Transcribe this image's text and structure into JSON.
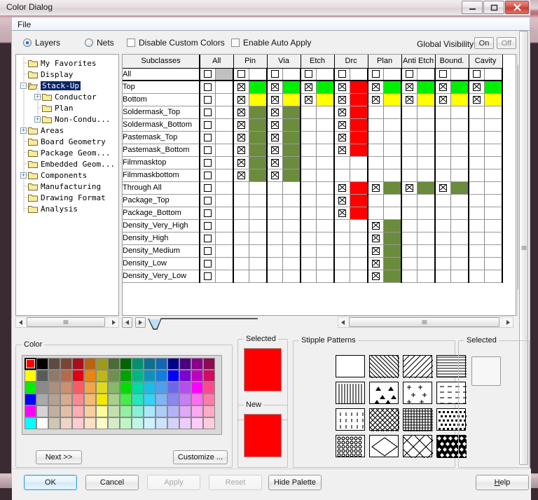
{
  "window": {
    "title": "Color Dialog",
    "controls": {
      "minimize": "minimize-icon",
      "maximize": "maximize-icon",
      "close": "close-icon"
    }
  },
  "menubar": {
    "file": "File"
  },
  "options": {
    "layers": "Layers",
    "nets": "Nets",
    "disable_custom_colors": "Disable Custom Colors",
    "enable_auto_apply": "Enable Auto Apply",
    "global_visibility_label": "Global Visibility:",
    "on": "On",
    "off": "Off"
  },
  "tree": {
    "items": [
      {
        "label": "My Favorites",
        "indent": 1,
        "expander": "",
        "selected": false
      },
      {
        "label": "Display",
        "indent": 1,
        "expander": "",
        "selected": false
      },
      {
        "label": "Stack-Up",
        "indent": 1,
        "expander": "-",
        "selected": true
      },
      {
        "label": "Conductor",
        "indent": 2,
        "expander": "+",
        "selected": false
      },
      {
        "label": "Plan",
        "indent": 2,
        "expander": "",
        "selected": false
      },
      {
        "label": "Non-Condu...",
        "indent": 2,
        "expander": "+",
        "selected": false
      },
      {
        "label": "Areas",
        "indent": 1,
        "expander": "+",
        "selected": false
      },
      {
        "label": "Board Geometry",
        "indent": 1,
        "expander": "",
        "selected": false
      },
      {
        "label": "Package Geom...",
        "indent": 1,
        "expander": "",
        "selected": false
      },
      {
        "label": "Embedded Geom...",
        "indent": 1,
        "expander": "",
        "selected": false
      },
      {
        "label": "Components",
        "indent": 1,
        "expander": "+",
        "selected": false
      },
      {
        "label": "Manufacturing",
        "indent": 1,
        "expander": "",
        "selected": false
      },
      {
        "label": "Drawing Format",
        "indent": 1,
        "expander": "",
        "selected": false
      },
      {
        "label": "Analysis",
        "indent": 1,
        "expander": "",
        "selected": false
      }
    ]
  },
  "table": {
    "columns": [
      "Subclasses",
      "All",
      "Pin",
      "Via",
      "Etch",
      "Drc",
      "Plan",
      "Anti Etch",
      "Bound.",
      "Cavity"
    ],
    "rows": [
      {
        "name": "All",
        "cells": [
          {
            "check": "empty",
            "color": "#c0c0c0"
          },
          {
            "check": "empty",
            "color": ""
          },
          {
            "check": "empty",
            "color": ""
          },
          {
            "check": "empty",
            "color": ""
          },
          {
            "check": "empty",
            "color": ""
          },
          {
            "check": "empty",
            "color": ""
          },
          {
            "check": "empty",
            "color": ""
          },
          {
            "check": "empty",
            "color": ""
          },
          {
            "check": "empty",
            "color": ""
          }
        ]
      },
      {
        "name": "Top",
        "cells": [
          {
            "check": "empty",
            "color": ""
          },
          {
            "check": "x",
            "color": "#00ee00"
          },
          {
            "check": "x",
            "color": "#00ee00"
          },
          {
            "check": "x",
            "color": "#00ee00"
          },
          {
            "check": "x",
            "color": "#ff0000"
          },
          {
            "check": "x",
            "color": "#00ee00"
          },
          {
            "check": "x",
            "color": "#00ee00"
          },
          {
            "check": "x",
            "color": "#00ee00"
          },
          {
            "check": "x",
            "color": "#00ee00"
          }
        ]
      },
      {
        "name": "Bottom",
        "cells": [
          {
            "check": "empty",
            "color": ""
          },
          {
            "check": "x",
            "color": "#ffff00"
          },
          {
            "check": "x",
            "color": "#ffff00"
          },
          {
            "check": "x",
            "color": "#ffff00"
          },
          {
            "check": "x",
            "color": "#ff0000"
          },
          {
            "check": "x",
            "color": "#ffff00"
          },
          {
            "check": "x",
            "color": "#ffff00"
          },
          {
            "check": "x",
            "color": "#ffff00"
          },
          {
            "check": "x",
            "color": "#ffff00"
          }
        ]
      },
      {
        "name": "Soldermask_Top",
        "cells": [
          {
            "check": "empty",
            "color": ""
          },
          {
            "check": "x",
            "color": "#6b8b3d"
          },
          {
            "check": "x",
            "color": "#6b8b3d"
          },
          {
            "check": "",
            "color": ""
          },
          {
            "check": "x",
            "color": "#ff0000"
          },
          {
            "check": "",
            "color": ""
          },
          {
            "check": "",
            "color": ""
          },
          {
            "check": "",
            "color": ""
          },
          {
            "check": "",
            "color": ""
          }
        ]
      },
      {
        "name": "Soldermask_Bottom",
        "cells": [
          {
            "check": "empty",
            "color": ""
          },
          {
            "check": "x",
            "color": "#6b8b3d"
          },
          {
            "check": "x",
            "color": "#6b8b3d"
          },
          {
            "check": "",
            "color": ""
          },
          {
            "check": "x",
            "color": "#ff0000"
          },
          {
            "check": "",
            "color": ""
          },
          {
            "check": "",
            "color": ""
          },
          {
            "check": "",
            "color": ""
          },
          {
            "check": "",
            "color": ""
          }
        ]
      },
      {
        "name": "Pastemask_Top",
        "cells": [
          {
            "check": "empty",
            "color": ""
          },
          {
            "check": "x",
            "color": "#6b8b3d"
          },
          {
            "check": "x",
            "color": "#6b8b3d"
          },
          {
            "check": "",
            "color": ""
          },
          {
            "check": "x",
            "color": "#ff0000"
          },
          {
            "check": "",
            "color": ""
          },
          {
            "check": "",
            "color": ""
          },
          {
            "check": "",
            "color": ""
          },
          {
            "check": "",
            "color": ""
          }
        ]
      },
      {
        "name": "Pastemask_Bottom",
        "cells": [
          {
            "check": "empty",
            "color": ""
          },
          {
            "check": "x",
            "color": "#6b8b3d"
          },
          {
            "check": "x",
            "color": "#6b8b3d"
          },
          {
            "check": "",
            "color": ""
          },
          {
            "check": "x",
            "color": "#ff0000"
          },
          {
            "check": "",
            "color": ""
          },
          {
            "check": "",
            "color": ""
          },
          {
            "check": "",
            "color": ""
          },
          {
            "check": "",
            "color": ""
          }
        ]
      },
      {
        "name": "Filmmasktop",
        "cells": [
          {
            "check": "empty",
            "color": ""
          },
          {
            "check": "x",
            "color": "#6b8b3d"
          },
          {
            "check": "x",
            "color": "#6b8b3d"
          },
          {
            "check": "",
            "color": ""
          },
          {
            "check": "",
            "color": ""
          },
          {
            "check": "",
            "color": ""
          },
          {
            "check": "",
            "color": ""
          },
          {
            "check": "",
            "color": ""
          },
          {
            "check": "",
            "color": ""
          }
        ]
      },
      {
        "name": "Filmmaskbottom",
        "cells": [
          {
            "check": "empty",
            "color": ""
          },
          {
            "check": "x",
            "color": "#6b8b3d"
          },
          {
            "check": "x",
            "color": "#6b8b3d"
          },
          {
            "check": "",
            "color": ""
          },
          {
            "check": "",
            "color": ""
          },
          {
            "check": "",
            "color": ""
          },
          {
            "check": "",
            "color": ""
          },
          {
            "check": "",
            "color": ""
          },
          {
            "check": "",
            "color": ""
          }
        ]
      },
      {
        "name": "Through All",
        "cells": [
          {
            "check": "empty",
            "color": ""
          },
          {
            "check": "",
            "color": ""
          },
          {
            "check": "",
            "color": ""
          },
          {
            "check": "",
            "color": ""
          },
          {
            "check": "x",
            "color": "#ff0000"
          },
          {
            "check": "x",
            "color": "#6b8b3d"
          },
          {
            "check": "x",
            "color": "#6b8b3d"
          },
          {
            "check": "x",
            "color": "#6b8b3d"
          },
          {
            "check": "",
            "color": ""
          }
        ]
      },
      {
        "name": "Package_Top",
        "cells": [
          {
            "check": "empty",
            "color": ""
          },
          {
            "check": "",
            "color": ""
          },
          {
            "check": "",
            "color": ""
          },
          {
            "check": "",
            "color": ""
          },
          {
            "check": "x",
            "color": "#ff0000"
          },
          {
            "check": "",
            "color": ""
          },
          {
            "check": "",
            "color": ""
          },
          {
            "check": "",
            "color": ""
          },
          {
            "check": "",
            "color": ""
          }
        ]
      },
      {
        "name": "Package_Bottom",
        "cells": [
          {
            "check": "empty",
            "color": ""
          },
          {
            "check": "",
            "color": ""
          },
          {
            "check": "",
            "color": ""
          },
          {
            "check": "",
            "color": ""
          },
          {
            "check": "x",
            "color": "#ff0000"
          },
          {
            "check": "",
            "color": ""
          },
          {
            "check": "",
            "color": ""
          },
          {
            "check": "",
            "color": ""
          },
          {
            "check": "",
            "color": ""
          }
        ]
      },
      {
        "name": "Density_Very_High",
        "cells": [
          {
            "check": "empty",
            "color": ""
          },
          {
            "check": "",
            "color": ""
          },
          {
            "check": "",
            "color": ""
          },
          {
            "check": "",
            "color": ""
          },
          {
            "check": "",
            "color": ""
          },
          {
            "check": "x",
            "color": "#6b8b3d"
          },
          {
            "check": "",
            "color": ""
          },
          {
            "check": "",
            "color": ""
          },
          {
            "check": "",
            "color": ""
          }
        ]
      },
      {
        "name": "Density_High",
        "cells": [
          {
            "check": "empty",
            "color": ""
          },
          {
            "check": "",
            "color": ""
          },
          {
            "check": "",
            "color": ""
          },
          {
            "check": "",
            "color": ""
          },
          {
            "check": "",
            "color": ""
          },
          {
            "check": "x",
            "color": "#6b8b3d"
          },
          {
            "check": "",
            "color": ""
          },
          {
            "check": "",
            "color": ""
          },
          {
            "check": "",
            "color": ""
          }
        ]
      },
      {
        "name": "Density_Medium",
        "cells": [
          {
            "check": "empty",
            "color": ""
          },
          {
            "check": "",
            "color": ""
          },
          {
            "check": "",
            "color": ""
          },
          {
            "check": "",
            "color": ""
          },
          {
            "check": "",
            "color": ""
          },
          {
            "check": "x",
            "color": "#6b8b3d"
          },
          {
            "check": "",
            "color": ""
          },
          {
            "check": "",
            "color": ""
          },
          {
            "check": "",
            "color": ""
          }
        ]
      },
      {
        "name": "Density_Low",
        "cells": [
          {
            "check": "empty",
            "color": ""
          },
          {
            "check": "",
            "color": ""
          },
          {
            "check": "",
            "color": ""
          },
          {
            "check": "",
            "color": ""
          },
          {
            "check": "",
            "color": ""
          },
          {
            "check": "x",
            "color": "#6b8b3d"
          },
          {
            "check": "",
            "color": ""
          },
          {
            "check": "",
            "color": ""
          },
          {
            "check": "",
            "color": ""
          }
        ]
      },
      {
        "name": "Density_Very_Low",
        "cells": [
          {
            "check": "empty",
            "color": ""
          },
          {
            "check": "",
            "color": ""
          },
          {
            "check": "",
            "color": ""
          },
          {
            "check": "",
            "color": ""
          },
          {
            "check": "",
            "color": ""
          },
          {
            "check": "x",
            "color": "#6b8b3d"
          },
          {
            "check": "",
            "color": ""
          },
          {
            "check": "",
            "color": ""
          },
          {
            "check": "",
            "color": ""
          }
        ]
      }
    ]
  },
  "color_group": {
    "title": "Color",
    "next_label": "Next >>",
    "customize_label": "Customize ...",
    "selected_index": 0,
    "palette_rows": [
      [
        "#ff0000",
        "#000000",
        "#5c4b40",
        "#7a4535",
        "#ab0d1c",
        "#b96312",
        "#9d9b1e",
        "#4b6b37",
        "#006400",
        "#009270",
        "#0e6f8e",
        "#1267b5",
        "#00008b",
        "#4b0082",
        "#8b008b",
        "#8b0a50"
      ],
      [
        "#ffff00",
        "#5a5a5a",
        "#8f7a6a",
        "#b66a4a",
        "#e00013",
        "#e8860f",
        "#bcb81a",
        "#6f9150",
        "#00a400",
        "#00b585",
        "#0e93b8",
        "#0e7fe0",
        "#0000ff",
        "#7b00d4",
        "#c000c0",
        "#d40a63"
      ],
      [
        "#00ee00",
        "#8a8a8a",
        "#ab8f7e",
        "#cc9070",
        "#fc5a62",
        "#f0a64a",
        "#e0d91c",
        "#8ab86a",
        "#00dd00",
        "#00d9a8",
        "#1bbde8",
        "#4f9ff0",
        "#6c68ee",
        "#b44ef0",
        "#ff00ff",
        "#fb4a8c"
      ],
      [
        "#0000ff",
        "#aaaaaa",
        "#b5a18f",
        "#d6ab90",
        "#fb8a90",
        "#f3bb74",
        "#f5e800",
        "#a9cf8c",
        "#44ee48",
        "#23e8bd",
        "#2fd4f8",
        "#7cb6f6",
        "#8a86f2",
        "#ca7ef6",
        "#ff6ef0",
        "#fb7ca8"
      ],
      [
        "#ff00ff",
        "#d4d4d4",
        "#c0b0a0",
        "#e3bfa8",
        "#fcaeb2",
        "#f8cfa0",
        "#fbfb9a",
        "#c4dfae",
        "#93f0a0",
        "#88f0d8",
        "#a8e8fb",
        "#abcdf8",
        "#b4b2f6",
        "#dfa8f8",
        "#ffa8f6",
        "#fdabc6"
      ],
      [
        "#00ffff",
        "#ffffff",
        "#d0c6b4",
        "#eed6c6",
        "#fdcdd0",
        "#fbe0c4",
        "#fdfdc8",
        "#d8ebc8",
        "#bef6c4",
        "#c0f6e8",
        "#cdf2fd",
        "#cde2fb",
        "#d4d2f8",
        "#eccdfb",
        "#fdcdf8",
        "#fdcddd"
      ]
    ]
  },
  "selected_group": {
    "title": "Selected",
    "color": "#ff0000"
  },
  "new_group": {
    "title": "New",
    "color": "#ff0000"
  },
  "stipple_group": {
    "title": "Stipple Patterns",
    "patterns": [
      "solid-blank",
      "diagonal-lines-right",
      "diagonal-lines-wide",
      "horizontal-lines",
      "vertical-lines",
      "triangles",
      "plus-marks",
      "dashes",
      "short-dashes",
      "cross-hatch-diagonal",
      "fine-grid",
      "diamond-dots",
      "circles",
      "large-diamond",
      "double-diagonal-cross",
      "dense-diamond-fill"
    ]
  },
  "stipple_selected_group": {
    "title": "Selected"
  },
  "buttons": {
    "ok": "OK",
    "cancel": "Cancel",
    "apply": "Apply",
    "reset": "Reset",
    "hide_palette": "Hide Palette",
    "help": "Help"
  }
}
